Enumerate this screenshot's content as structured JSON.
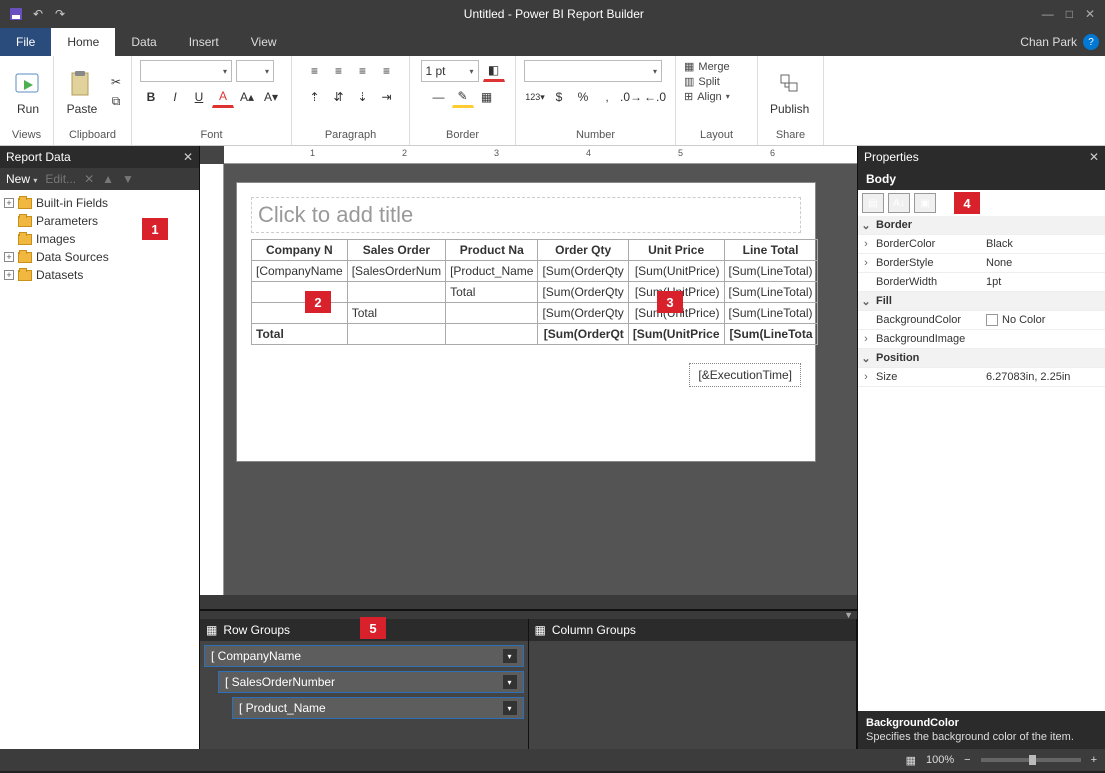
{
  "titlebar": {
    "title": "Untitled - Power BI Report Builder"
  },
  "menubar": {
    "file": "File",
    "tabs": [
      "Home",
      "Data",
      "Insert",
      "View"
    ],
    "active": "Home",
    "user": "Chan Park"
  },
  "ribbon": {
    "views": {
      "run": "Run",
      "label": "Views"
    },
    "clipboard": {
      "paste": "Paste",
      "label": "Clipboard"
    },
    "font": {
      "label": "Font"
    },
    "paragraph": {
      "label": "Paragraph"
    },
    "border": {
      "width": "1 pt",
      "label": "Border"
    },
    "number": {
      "label": "Number"
    },
    "layout": {
      "merge": "Merge",
      "split": "Split",
      "align": "Align",
      "label": "Layout"
    },
    "share": {
      "publish": "Publish",
      "label": "Share"
    }
  },
  "reportData": {
    "title": "Report Data",
    "new": "New",
    "edit": "Edit...",
    "items": [
      "Built-in Fields",
      "Parameters",
      "Images",
      "Data Sources",
      "Datasets"
    ]
  },
  "design": {
    "titlePlaceholder": "Click to add title",
    "headers": [
      "Company N",
      "Sales Order",
      "Product Na",
      "Order Qty",
      "Unit Price",
      "Line Total"
    ],
    "row1": [
      "[CompanyName",
      "[SalesOrderNum",
      "[Product_Name",
      "[Sum(OrderQty",
      "[Sum(UnitPrice)",
      "[Sum(LineTotal)"
    ],
    "row2": [
      "",
      "",
      "Total",
      "[Sum(OrderQty",
      "[Sum(UnitPrice)",
      "[Sum(LineTotal)"
    ],
    "row3": [
      "",
      "Total",
      "",
      "[Sum(OrderQty",
      "[Sum(UnitPrice)",
      "[Sum(LineTotal)"
    ],
    "row4": [
      "Total",
      "",
      "",
      "[Sum(OrderQt",
      "[Sum(UnitPrice",
      "[Sum(LineTota"
    ],
    "execTime": "[&ExecutionTime]"
  },
  "groups": {
    "rowTitle": "Row Groups",
    "colTitle": "Column Groups",
    "rows": [
      "CompanyName",
      "SalesOrderNumber",
      "Product_Name"
    ]
  },
  "properties": {
    "title": "Properties",
    "object": "Body",
    "catBorder": "Border",
    "borderColor": {
      "name": "BorderColor",
      "val": "Black"
    },
    "borderStyle": {
      "name": "BorderStyle",
      "val": "None"
    },
    "borderWidth": {
      "name": "BorderWidth",
      "val": "1pt"
    },
    "catFill": "Fill",
    "bgColor": {
      "name": "BackgroundColor",
      "val": "No Color"
    },
    "bgImage": {
      "name": "BackgroundImage",
      "val": ""
    },
    "catPosition": "Position",
    "size": {
      "name": "Size",
      "val": "6.27083in, 2.25in"
    },
    "desc": {
      "title": "BackgroundColor",
      "text": "Specifies the background color of the item."
    }
  },
  "status": {
    "zoom": "100%"
  },
  "callouts": {
    "c1": "1",
    "c2": "2",
    "c3": "3",
    "c4": "4",
    "c5": "5"
  }
}
